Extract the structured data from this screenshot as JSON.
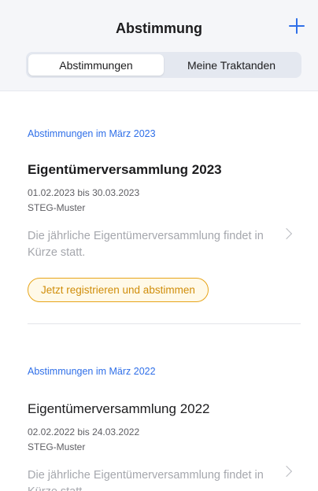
{
  "header": {
    "title": "Abstimmung",
    "add_icon": "plus-icon",
    "tabs": [
      {
        "label": "Abstimmungen",
        "active": true
      },
      {
        "label": "Meine Traktanden",
        "active": false
      }
    ]
  },
  "sections": [
    {
      "label": "Abstimmungen im März 2023",
      "item": {
        "title": "Eigentümerversammlung 2023",
        "dates": "01.02.2023 bis 30.03.2023",
        "owner": "STEG-Muster",
        "description": "Die jährliche Eigentümerversammlung findet in Kürze statt.",
        "action": "Jetzt registrieren und abstimmen"
      }
    },
    {
      "label": "Abstimmungen im März 2022",
      "item": {
        "title": "Eigentümerversammlung 2022",
        "dates": "02.02.2022 bis 24.03.2022",
        "owner": "STEG-Muster",
        "description": "Die jährliche Eigentümerversammlung findet in Kürze statt."
      }
    }
  ],
  "colors": {
    "accent": "#2f6fe8",
    "cta_border": "#e7a51a",
    "cta_text": "#d08d0a"
  }
}
